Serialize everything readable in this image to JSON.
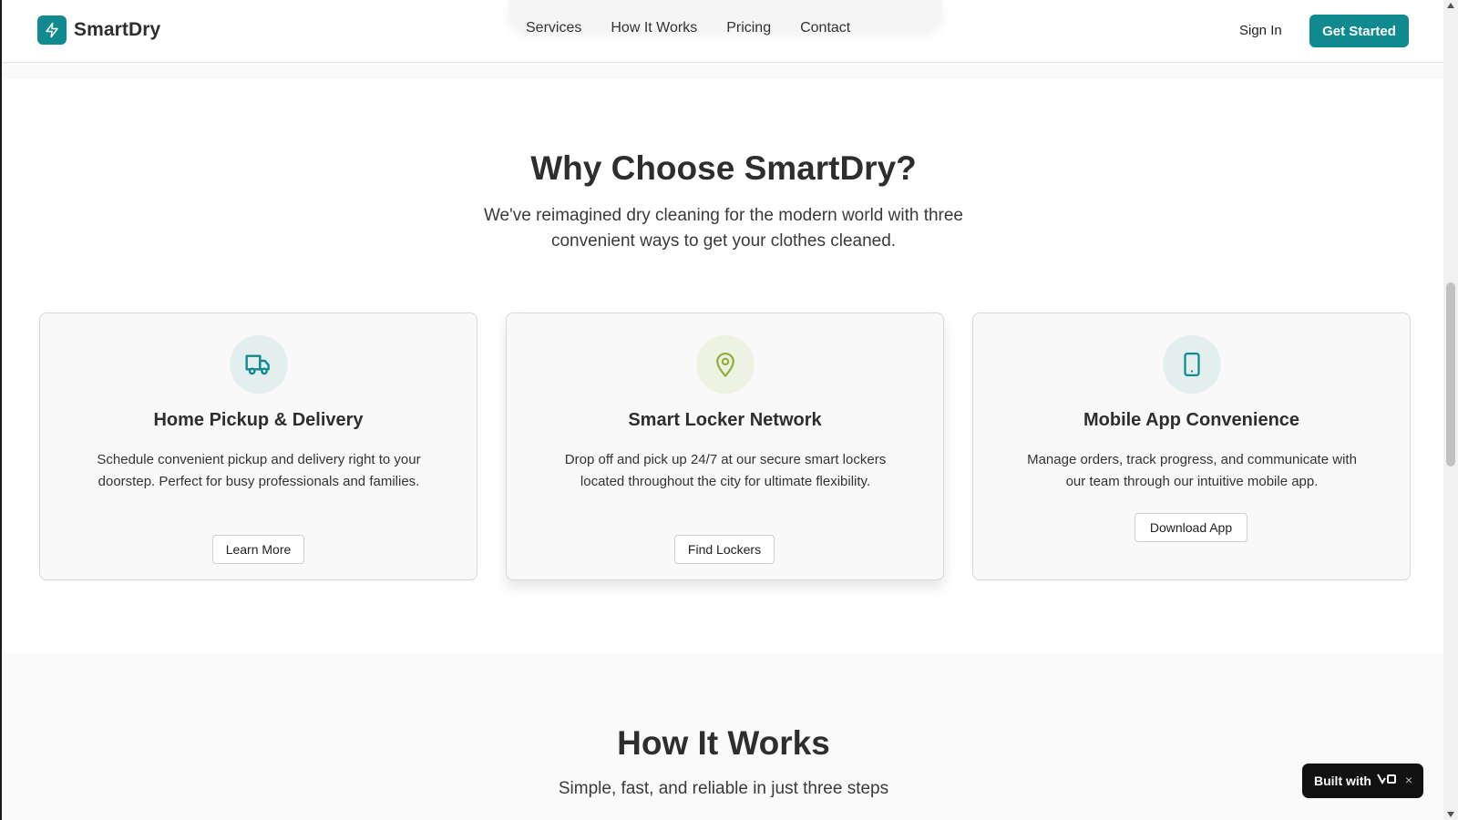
{
  "header": {
    "brand": "SmartDry",
    "nav": [
      "Services",
      "How It Works",
      "Pricing",
      "Contact"
    ],
    "sign_in": "Sign In",
    "get_started": "Get Started"
  },
  "why": {
    "title": "Why Choose SmartDry?",
    "subtitle": "We've reimagined dry cleaning for the modern world with three convenient ways to get your clothes cleaned.",
    "cards": [
      {
        "icon": "truck-icon",
        "title": "Home Pickup & Delivery",
        "description": "Schedule convenient pickup and delivery right to your doorstep. Perfect for busy professionals and families.",
        "button": "Learn More"
      },
      {
        "icon": "map-pin-icon",
        "title": "Smart Locker Network",
        "description": "Drop off and pick up 24/7 at our secure smart lockers located throughout the city for ultimate flexibility.",
        "button": "Find Lockers"
      },
      {
        "icon": "smartphone-icon",
        "title": "Mobile App Convenience",
        "description": "Manage orders, track progress, and communicate with our team through our intuitive mobile app.",
        "button": "Download App"
      }
    ]
  },
  "how": {
    "title": "How It Works",
    "subtitle": "Simple, fast, and reliable in just three steps"
  },
  "toast": {
    "label": "Built with",
    "close": "×"
  },
  "colors": {
    "brand": "#0f8a8f",
    "locker_icon": "#8fae3b"
  }
}
